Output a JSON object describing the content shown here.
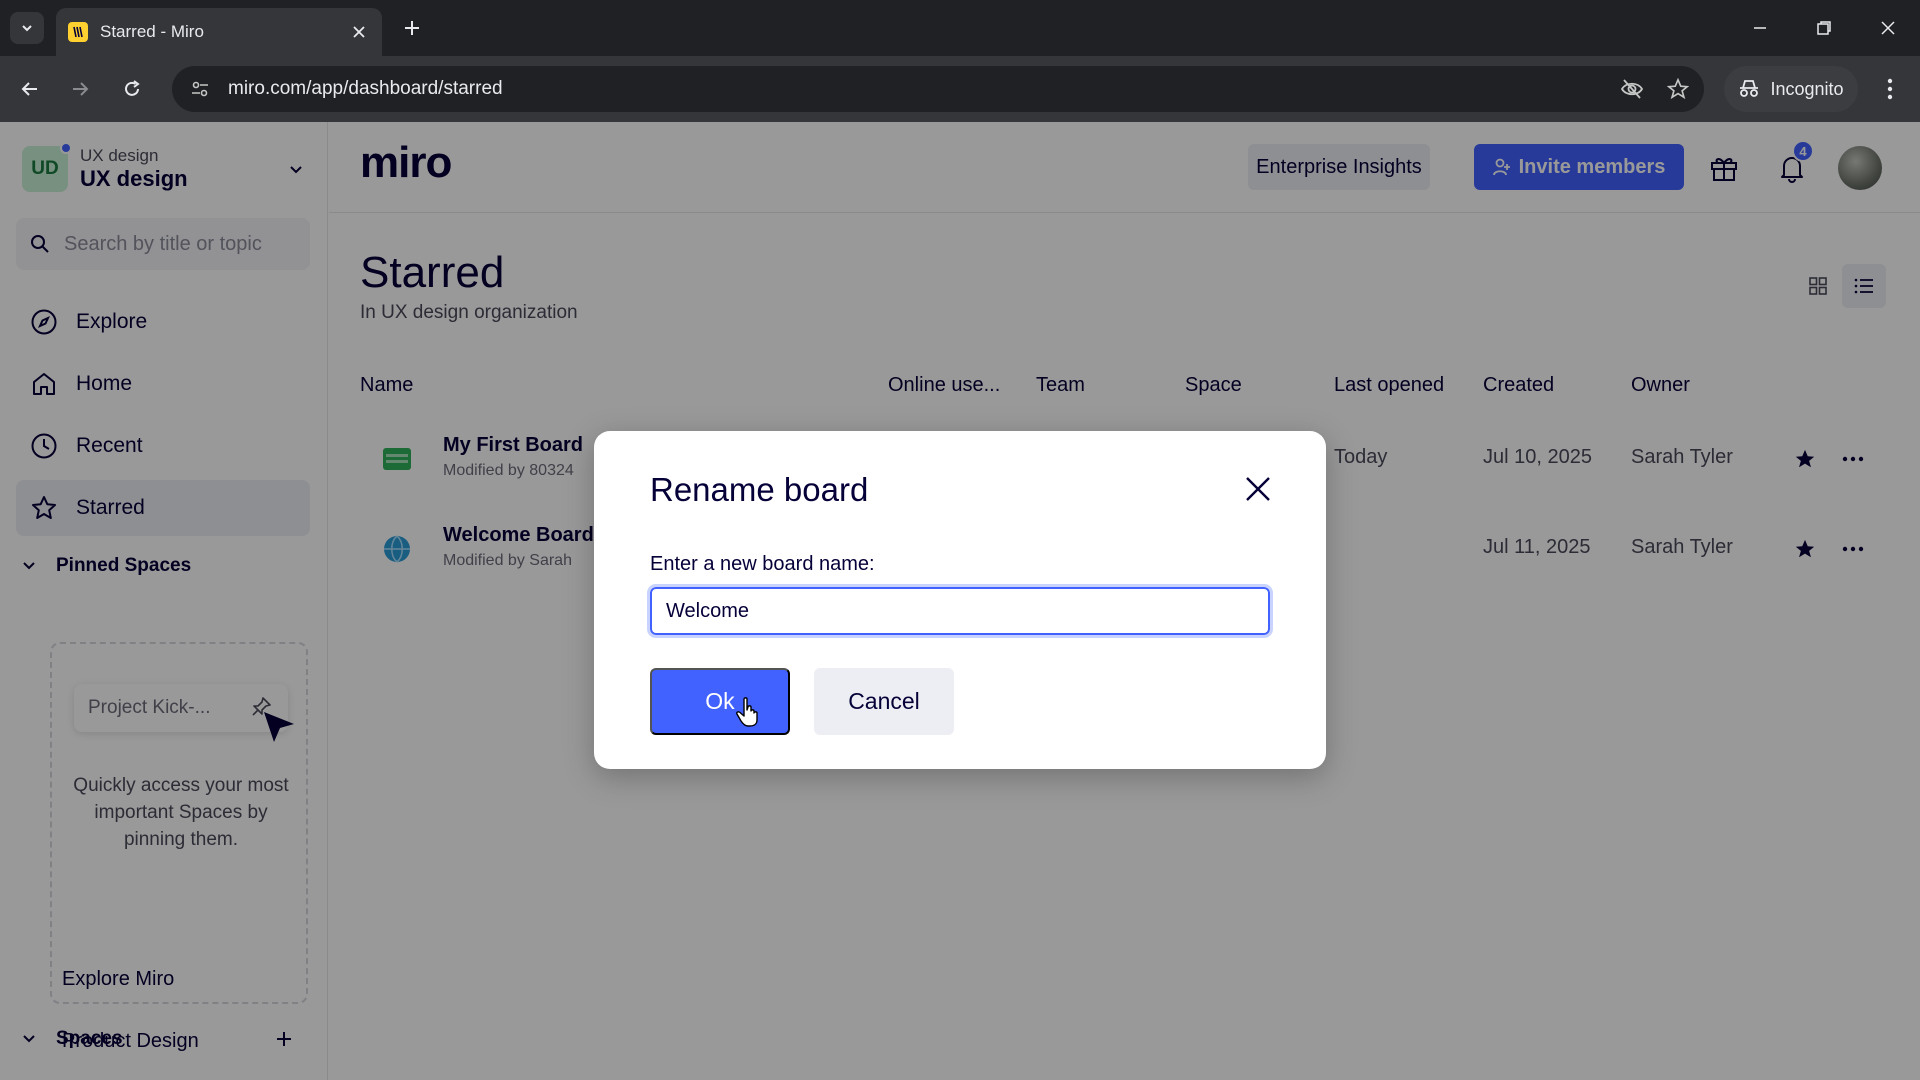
{
  "browser": {
    "tab_title": "Starred - Miro",
    "url": "miro.com/app/dashboard/starred",
    "incognito_label": "Incognito"
  },
  "sidebar": {
    "org_sub": "UX design",
    "org_name": "UX design",
    "org_initials": "UD",
    "search_placeholder": "Search by title or topic",
    "nav": [
      {
        "label": "Explore",
        "icon": "compass-icon"
      },
      {
        "label": "Home",
        "icon": "home-icon"
      },
      {
        "label": "Recent",
        "icon": "clock-icon"
      },
      {
        "label": "Starred",
        "icon": "star-icon",
        "active": true
      }
    ],
    "pinned_title": "Pinned Spaces",
    "pinned_chip": "Project Kick-...",
    "pinned_help": "Quickly access your most important Spaces by pinning them.",
    "spaces_title": "Spaces",
    "spaces": [
      "Explore Miro",
      "Product Design"
    ]
  },
  "header": {
    "logo": "miro",
    "insights_label": "Enterprise Insights",
    "invite_label": "Invite members",
    "notification_count": "4"
  },
  "page": {
    "title": "Starred",
    "subtitle": "In UX design organization"
  },
  "table": {
    "columns": [
      "Name",
      "Online use...",
      "Team",
      "Space",
      "Last opened",
      "Created",
      "Owner"
    ],
    "rows": [
      {
        "name": "My First Board",
        "modified": "Modified by 80324",
        "last_opened": "Today",
        "created": "Jul 10, 2025",
        "owner": "Sarah Tyler"
      },
      {
        "name": "Welcome Board",
        "modified": "Modified by Sarah",
        "last_opened": "",
        "created": "Jul 11, 2025",
        "owner": "Sarah Tyler"
      }
    ]
  },
  "modal": {
    "title": "Rename board",
    "label": "Enter a new board name:",
    "input_value": "Welcome",
    "ok_label": "Ok",
    "cancel_label": "Cancel"
  },
  "colors": {
    "accent": "#4262ff",
    "text": "#050038",
    "star": "#050038"
  }
}
